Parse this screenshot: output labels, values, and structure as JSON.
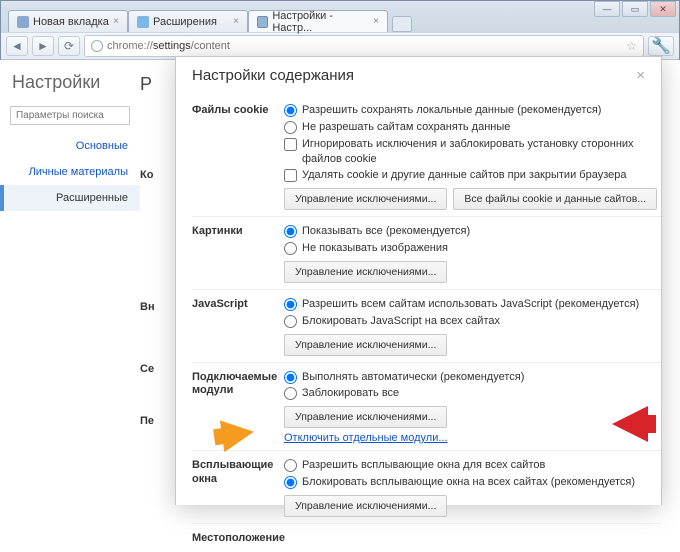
{
  "tabs": [
    {
      "label": "Новая вкладка"
    },
    {
      "label": "Расширения"
    },
    {
      "label": "Настройки - Настр..."
    }
  ],
  "url": {
    "prefix": "chrome://",
    "bold": "settings",
    "suffix": "/content"
  },
  "sidebar": {
    "title": "Настройки",
    "search_placeholder": "Параметры поиска",
    "links": {
      "basic": "Основные",
      "personal": "Личные материалы",
      "advanced": "Расширенные"
    }
  },
  "bg": {
    "header_letter": "Р",
    "s1": "Ко",
    "s2": "Вн",
    "s3": "Се",
    "s4": "Пе"
  },
  "modal": {
    "title": "Настройки содержания",
    "manage_exceptions": "Управление исключениями...",
    "cookies": {
      "label": "Файлы cookie",
      "o1": "Разрешить сохранять локальные данные (рекомендуется)",
      "o2": "Не разрешать сайтам сохранять данные",
      "o3": "Игнорировать исключения и заблокировать установку сторонних файлов cookie",
      "o4": "Удалять cookie и другие данные сайтов при закрытии браузера",
      "btn2": "Все файлы cookie и данные сайтов..."
    },
    "images": {
      "label": "Картинки",
      "o1": "Показывать все (рекомендуется)",
      "o2": "Не показывать изображения"
    },
    "javascript": {
      "label": "JavaScript",
      "o1": "Разрешить всем сайтам использовать JavaScript (рекомендуется)",
      "o2": "Блокировать JavaScript на всех сайтах"
    },
    "plugins": {
      "label": "Подключаемые модули",
      "o1": "Выполнять автоматически (рекомендуется)",
      "o2": "Заблокировать все",
      "link": "Отключить отдельные модули..."
    },
    "popups": {
      "label": "Всплывающие окна",
      "o1": "Разрешить всплывающие окна для всех сайтов",
      "o2": "Блокировать всплывающие окна на всех сайтах (рекомендуется)"
    },
    "location": {
      "label": "Местоположение"
    }
  }
}
